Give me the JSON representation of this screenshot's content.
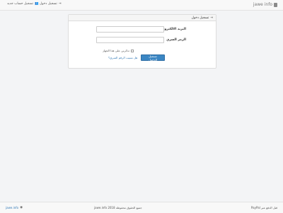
{
  "navbar": {
    "brand": "jawe info",
    "login": "تسجيل دخول",
    "register": "تسجيل حساب جديد"
  },
  "panel": {
    "title": "تسجيل دخول",
    "email_label": "البريد الالكتروني",
    "password_label": "الرمز السري",
    "email_value": "",
    "password_value": "",
    "remember": "تذكرني على هذا الجهاز",
    "submit": "تسجيل الدخول",
    "forgot": "هل نسيت الرقم السري؟"
  },
  "footer": {
    "left": "jawe.info",
    "center": "جميع الحقوق محفوظة jawe.info 2018",
    "right": "قبل الدفع عبر PayPal"
  }
}
